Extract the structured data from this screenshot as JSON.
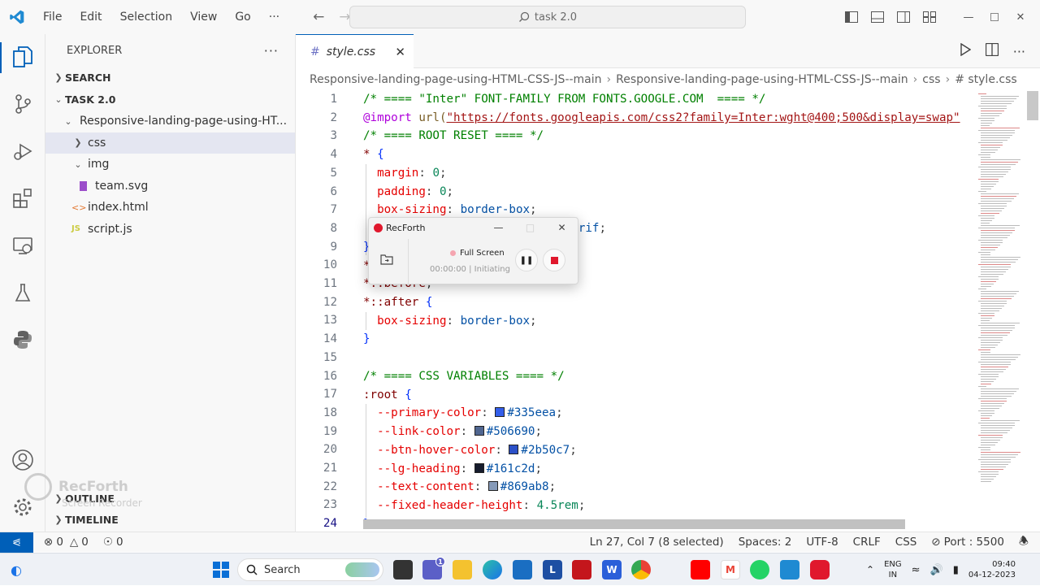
{
  "menu": {
    "items": [
      "File",
      "Edit",
      "Selection",
      "View",
      "Go",
      "···"
    ]
  },
  "command_center": {
    "text": "task 2.0"
  },
  "sidebar": {
    "title": "EXPLORER",
    "sections": {
      "search": "SEARCH",
      "folder": "TASK 2.0",
      "outline": "OUTLINE",
      "timeline": "TIMELINE"
    },
    "tree": {
      "root": "Responsive-landing-page-using-HT...",
      "css": "css",
      "img": "img",
      "team_svg": "team.svg",
      "index_html": "index.html",
      "script_js": "script.js"
    },
    "icons": {
      "html": "<>",
      "js": "JS"
    }
  },
  "tab": {
    "name": "style.css",
    "icon": "#"
  },
  "breadcrumb": [
    "Responsive-landing-page-using-HTML-CSS-JS--main",
    "Responsive-landing-page-using-HTML-CSS-JS--main",
    "css",
    "# style.css"
  ],
  "editor": {
    "line_numbers": [
      "1",
      "2",
      "3",
      "4",
      "5",
      "6",
      "7",
      "8",
      "9",
      "10",
      "11",
      "12",
      "13",
      "14",
      "15",
      "16",
      "17",
      "18",
      "19",
      "20",
      "21",
      "22",
      "23",
      "24"
    ],
    "colors": {
      "primary": "#335eea",
      "link": "#506690",
      "btn_hover": "#2b50c7",
      "lg_heading": "#161c2d",
      "text_content": "#869ab8"
    }
  },
  "recorder": {
    "app": "RecForth",
    "mode": "Full Screen",
    "time": "00:00:00",
    "state": "Initiating"
  },
  "watermark": {
    "name": "RecForth",
    "sub": "Screen Recorder"
  },
  "status": {
    "errors": "0",
    "warnings": "0",
    "ports": "0",
    "cursor": "Ln 27, Col 7 (8 selected)",
    "spaces": "Spaces: 2",
    "encoding": "UTF-8",
    "eol": "CRLF",
    "language": "CSS",
    "port": "Port : 5500"
  },
  "taskbar": {
    "search": "Search",
    "lang": "ENG",
    "region": "IN",
    "time": "09:40",
    "date": "04-12-2023",
    "badge": "1",
    "apps": {
      "l": "L",
      "w": "W"
    }
  }
}
